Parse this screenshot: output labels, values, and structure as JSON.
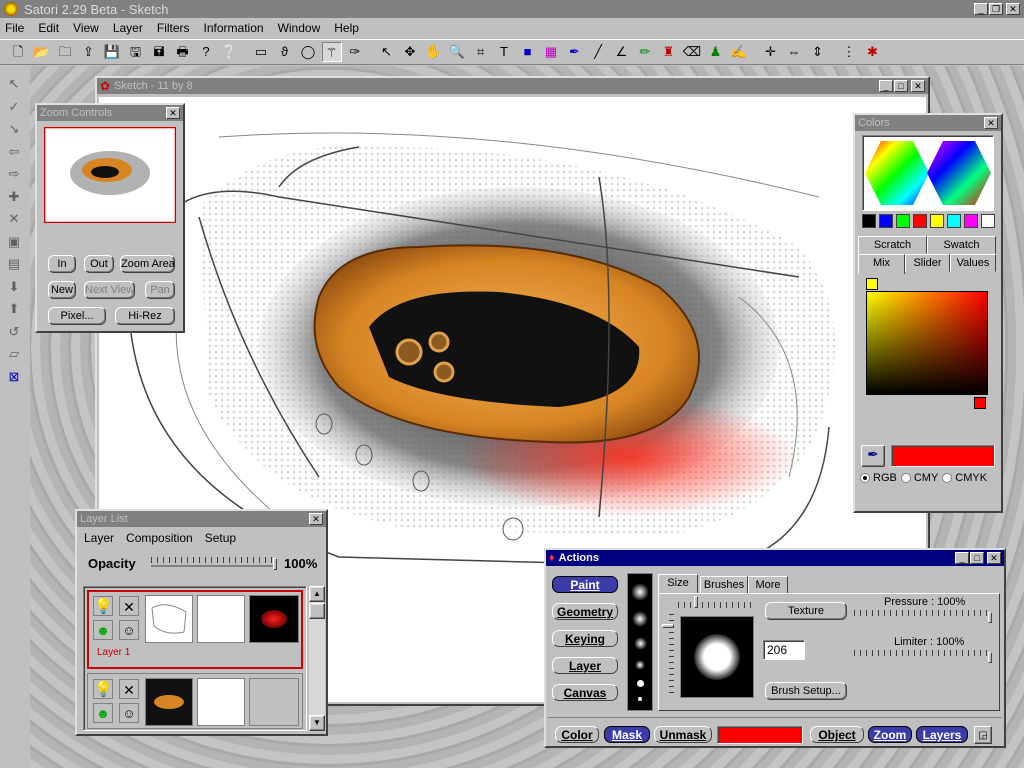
{
  "app": {
    "title": "Satori 2.29 Beta - Sketch"
  },
  "menu": [
    "File",
    "Edit",
    "View",
    "Layer",
    "Filters",
    "Information",
    "Window",
    "Help"
  ],
  "toolbar_icons": [
    "new-file-icon",
    "open-file-icon",
    "open-image-icon",
    "import-icon",
    "save-icon",
    "save-as-icon",
    "save-image-icon",
    "print-icon",
    "context-help-icon",
    "help-icon",
    "rectangle-tool-icon",
    "lasso-tool-icon",
    "ellipse-tool-icon",
    "magic-wand-icon",
    "brush-select-icon",
    "pointer-tool-icon",
    "move-tool-icon",
    "hand-tool-icon",
    "zoom-tool-icon",
    "crop-tool-icon",
    "text-tool-icon",
    "color-swap-icon",
    "gradient-icon",
    "pen-tool-icon",
    "line-tool-icon",
    "angle-tool-icon",
    "pencil-tool-icon",
    "stamp-tool-icon",
    "eraser-tool-icon",
    "fill-tool-icon",
    "smudge-tool-icon",
    "move-layer-icon",
    "flip-horizontal-icon",
    "flip-vertical-icon",
    "grid-icon",
    "settings-tool-icon"
  ],
  "left_tools": [
    "pointer-icon",
    "check-icon",
    "deselect-icon",
    "arrow-left-icon",
    "arrow-right-icon",
    "add-icon",
    "delete-icon",
    "copy-icon",
    "paste-icon",
    "arrow-down-icon",
    "arrow-up-icon",
    "rotate-icon",
    "skew-icon",
    "transform-icon"
  ],
  "sketch_window": {
    "title": "Sketch - 11 by 8"
  },
  "zoom_controls": {
    "title": "Zoom Controls",
    "buttons": {
      "in": "In",
      "out": "Out",
      "zoom_area": "Zoom Area",
      "new": "New",
      "next_view": "Next View",
      "pan": "Pan",
      "pixel": "Pixel...",
      "hirez": "Hi-Rez"
    }
  },
  "colors_panel": {
    "title": "Colors",
    "swatches": [
      "#000000",
      "#0000ff",
      "#00ff00",
      "#ff0000",
      "#ffff00",
      "#00ffff",
      "#ff00ff",
      "#ffffff"
    ],
    "tabs_top": [
      "Scratch",
      "Swatch"
    ],
    "tabs_bottom": [
      "Mix",
      "Slider",
      "Values"
    ],
    "current_color": "#ff0000",
    "modes": [
      "RGB",
      "CMY",
      "CMYK"
    ],
    "selected_mode": "RGB"
  },
  "layer_list": {
    "title": "Layer List",
    "menu": [
      "Layer",
      "Composition",
      "Setup"
    ],
    "opacity_label": "Opacity",
    "opacity_value": "100%",
    "opacity_fraction": 1.0,
    "layers": [
      {
        "name": "Layer 1",
        "selected": true
      },
      {
        "name": "",
        "selected": false
      }
    ]
  },
  "actions_panel": {
    "title": "Actions",
    "side_buttons": [
      "Paint",
      "Geometry",
      "Keying",
      "Layer",
      "Canvas"
    ],
    "active_button": "Paint",
    "tabs": [
      "Size",
      "Brushes",
      "More"
    ],
    "texture_label": "Texture",
    "brush_size": "206",
    "brush_setup_label": "Brush Setup...",
    "pressure_label": "Pressure : 100%",
    "limiter_label": "Limiter : 100%",
    "bottom": {
      "color": "Color",
      "mask": "Mask",
      "unmask": "Unmask",
      "object": "Object",
      "zoom": "Zoom",
      "layers": "Layers"
    },
    "current_color": "#ff0000"
  }
}
